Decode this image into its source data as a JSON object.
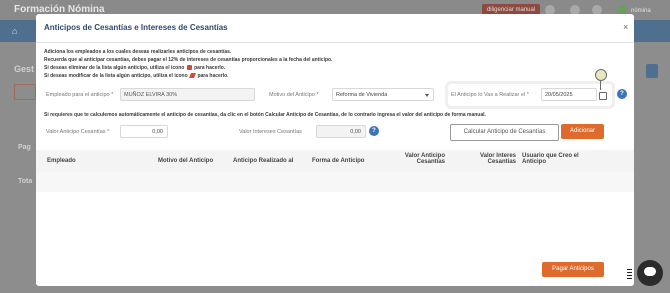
{
  "app": {
    "title": "Formación Nómina",
    "header_button": "diligenciar manual",
    "user_label": "nómina",
    "bg_heading": "Gest",
    "bg_left_label_1": "Pag",
    "bg_left_label_2": "Tota"
  },
  "modal": {
    "title": "Anticipos de Cesantías e Intereses de Cesantías",
    "close_label": "×",
    "info_lines": [
      "Adiciona los empleados a los cuales deseas realizarles anticipos de cesantías.",
      "Recuerda que al anticipar cesantías, debes pagar el 12% de intereses de cesantías proporcionales a la fecha del anticipo.",
      "Si deseas eliminar de la lista algún anticipo, utiliza el icono",
      "Si deseas modificar de la lista algún anticipo, utiliza el icono"
    ],
    "info_suffix": "para hacerlo.",
    "fields": {
      "employee_label": "Empleado para el anticipo *",
      "employee_value": "MUÑOZ  ELVIRA 30%",
      "reason_label": "Motivo del Anticipo *",
      "reason_value": "Reforma de Vivienda",
      "date_label": "El Anticipo lo Vas a Realizar el *",
      "date_value": "20/05/2025",
      "calc_note": "Si requieres que te calculemos automáticamente el anticipo de cesantías, da clic en el botón Calcular Anticipo de Cesantías, de lo contrario ingresa el valor del anticipo de forma manual.",
      "advance_value_label": "Valor Anticipo Cesantías *",
      "advance_value": "0,00",
      "interest_label": "Valor Intereses Cesantías",
      "interest_value": "0,00"
    },
    "buttons": {
      "calculate": "Calcular Anticipo de Cesantías",
      "add": "Adicionar",
      "pay": "Pagar Anticipos"
    },
    "table": {
      "headers": [
        "Empleado",
        "Motivo del Anticipo",
        "Anticipo Realizado al",
        "Forma de Anticipo",
        "Valor Anticipo Cesantías",
        "Valor Interes Cesantias",
        "Usuario que Creo el Anticipo"
      ]
    }
  },
  "colors": {
    "accent": "#de6a2b",
    "title": "#2f4a6b",
    "help": "#3b74b8"
  }
}
